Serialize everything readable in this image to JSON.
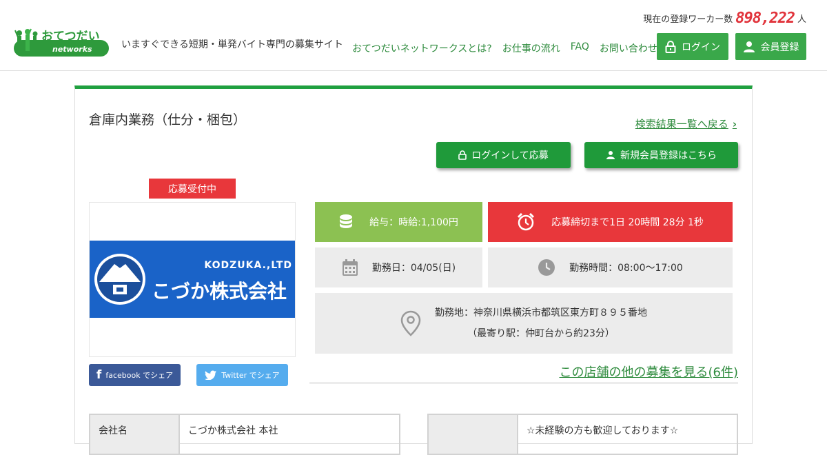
{
  "header": {
    "tagline": "いますぐできる短期・単発バイト専門の募集サイト",
    "worker_count_label": "現在の登録ワーカー数",
    "worker_count": "898,222",
    "worker_count_unit": "人",
    "logo_text": "おてつだい",
    "logo_subtext": "networks",
    "nav": [
      "おてつだいネットワークスとは?",
      "お仕事の流れ",
      "FAQ",
      "お問い合わせ"
    ],
    "login_label": "ログイン",
    "register_label": "会員登録"
  },
  "job": {
    "title": "倉庫内業務（仕分・梱包）",
    "back_link": "検索結果一覧へ戻る",
    "apply_label": "ログインして応募",
    "new_register_label": "新規会員登録はこちら",
    "status": "応募受付中",
    "photo": {
      "company_en": "KODZUKA.,LTD",
      "company_jp": "こづか株式会社"
    },
    "share_facebook": "facebook でシェア",
    "share_twitter": "Twitter でシェア",
    "salary": "給与：時給:1,100円",
    "deadline": "応募締切まで1日 20時間 28分 1秒",
    "work_date": "勤務日：04/05(日)",
    "work_time": "勤務時間：08:00～17:00",
    "location": "勤務地：神奈川県横浜市都筑区東方町８９５番地",
    "nearest_station": "（最寄り駅：仲町台から約23分）",
    "other_jobs_link": "この店舗の他の募集を見る(6件)"
  },
  "details": {
    "company_label": "会社名",
    "company_value": "こづか株式会社 本社",
    "note_label": "",
    "note_value": "☆未経験の方も歓迎しております☆"
  },
  "colors": {
    "brand_green": "#1f9a3a",
    "header_button_green": "#3aa84a",
    "salary_green": "#8cc152",
    "alert_red": "#e8373b",
    "link_green": "#2e8b3d",
    "counter_red": "#e1343c"
  }
}
